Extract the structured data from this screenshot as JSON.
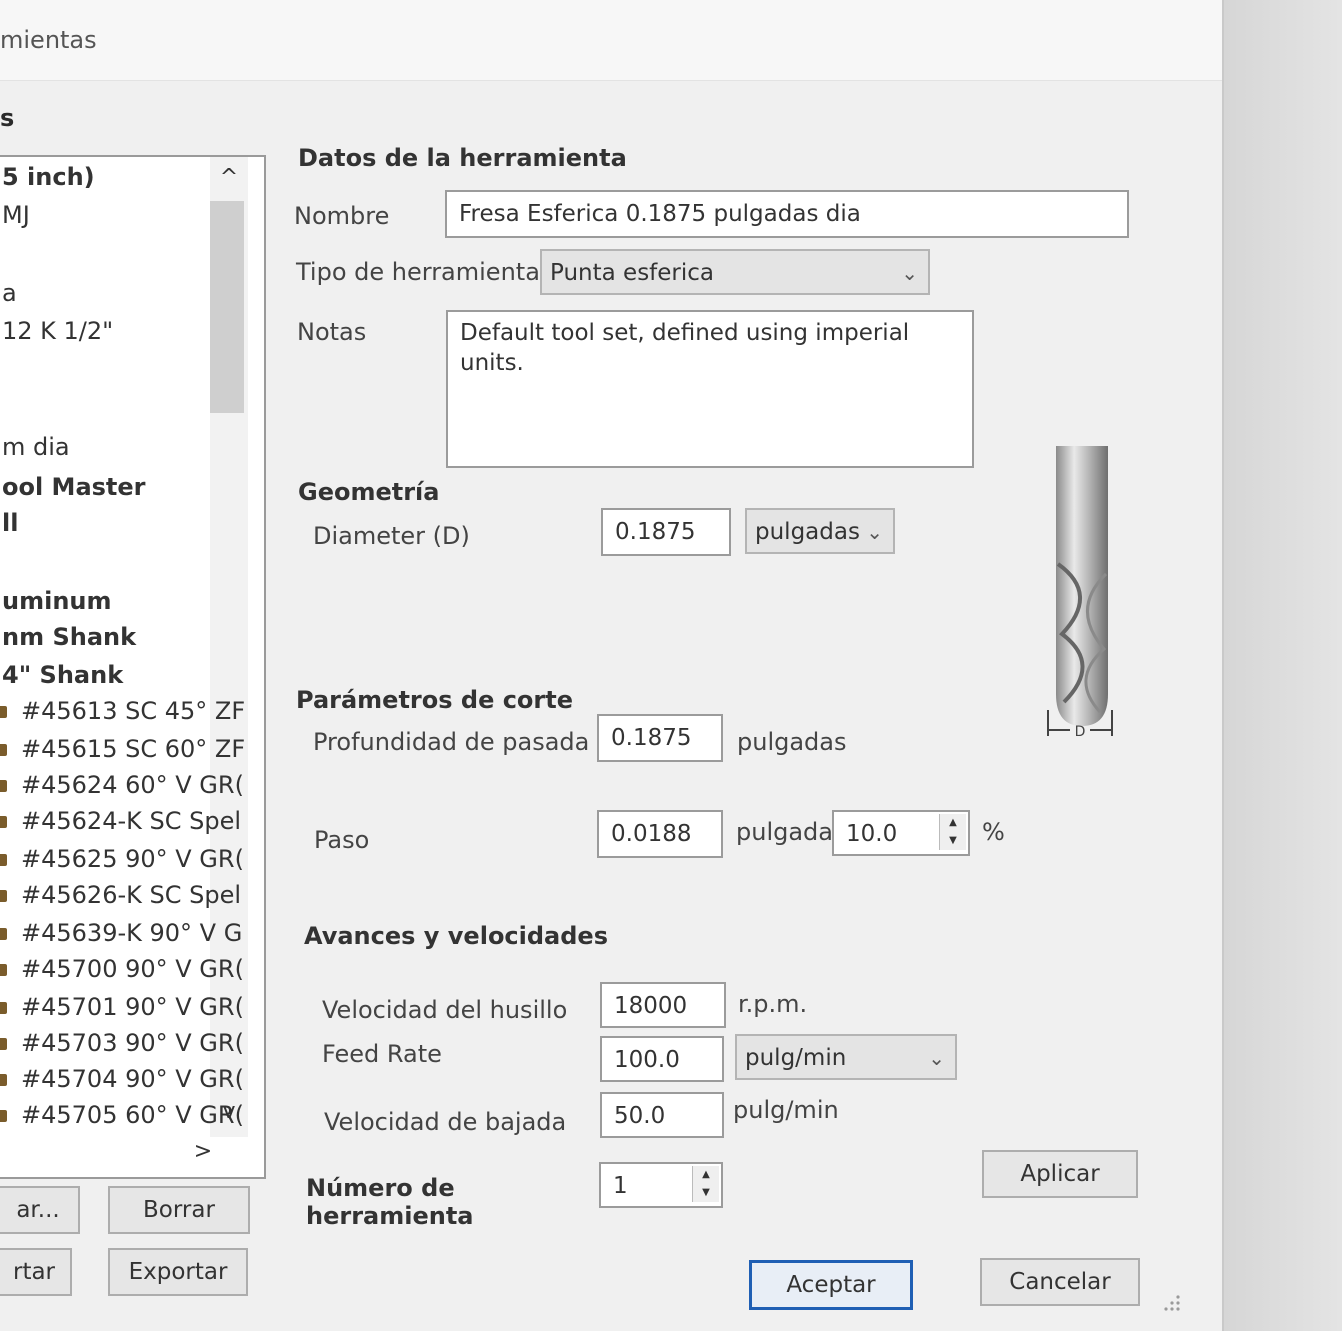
{
  "window": {
    "title": "mientas",
    "list_label": "s"
  },
  "tool_list": {
    "items": [
      {
        "text": "5 inch)",
        "bold": true
      },
      {
        "text": "MJ",
        "bold": false
      },
      {
        "text": "",
        "bold": false
      },
      {
        "text": "a",
        "bold": false
      },
      {
        "text": "12 K 1/2\"",
        "bold": false
      },
      {
        "text": "",
        "bold": false
      },
      {
        "text": "",
        "bold": false
      },
      {
        "text": "m dia",
        "bold": false
      },
      {
        "text": "ool Master",
        "bold": true
      },
      {
        "text": "ll",
        "bold": true
      },
      {
        "text": "",
        "bold": false
      },
      {
        "text": "uminum",
        "bold": true
      },
      {
        "text": "nm Shank",
        "bold": true
      },
      {
        "text": "4\" Shank",
        "bold": true
      },
      {
        "text": "#45613 SC 45° ZF",
        "bold": false
      },
      {
        "text": "#45615 SC 60° ZF",
        "bold": false
      },
      {
        "text": "#45624 60° V GR(",
        "bold": false
      },
      {
        "text": "#45624-K SC Spel",
        "bold": false
      },
      {
        "text": "#45625 90° V GR(",
        "bold": false
      },
      {
        "text": "#45626-K SC Spel",
        "bold": false
      },
      {
        "text": "#45639-K 90° V G",
        "bold": false
      },
      {
        "text": "#45700 90° V GR(",
        "bold": false
      },
      {
        "text": "#45701 90° V GR(",
        "bold": false
      },
      {
        "text": "#45703 90° V GR(",
        "bold": false
      },
      {
        "text": "#45704 90° V GR(",
        "bold": false
      },
      {
        "text": "#45705 60° V GR(",
        "bold": false
      }
    ],
    "scroll_up": "^",
    "scroll_down": "v",
    "scroll_right": ">"
  },
  "list_buttons": {
    "add": "ar...",
    "delete": "Borrar",
    "import": "rtar",
    "export": "Exportar"
  },
  "tool_data": {
    "section": "Datos de la herramienta",
    "name_label": "Nombre",
    "name_value": "Fresa Esferica 0.1875 pulgadas dia",
    "type_label": "Tipo de herramienta",
    "type_value": "Punta esferica",
    "notes_label": "Notas",
    "notes_value": "Default tool set, defined using imperial units."
  },
  "geometry": {
    "section": "Geometría",
    "diameter_label": "Diameter (D)",
    "diameter_value": "0.1875",
    "units_value": "pulgadas",
    "diagram_label": "D"
  },
  "cutting": {
    "section": "Parámetros de corte",
    "pass_depth_label": "Profundidad de pasada",
    "pass_depth_value": "0.1875",
    "pass_depth_unit": "pulgadas",
    "stepover_label": "Paso",
    "stepover_value": "0.0188",
    "stepover_unit": "pulgada",
    "stepover_percent": "10.0",
    "percent_sign": "%"
  },
  "feeds": {
    "section": "Avances y velocidades",
    "spindle_label": "Velocidad del husillo",
    "spindle_value": "18000",
    "spindle_unit": "r.p.m.",
    "feed_label": "Feed Rate",
    "feed_value": "100.0",
    "feed_unit": "pulg/min",
    "plunge_label": "Velocidad de bajada",
    "plunge_value": "50.0",
    "plunge_unit": "pulg/min"
  },
  "tool_number": {
    "label_line1": "Número de",
    "label_line2": "herramienta",
    "value": "1"
  },
  "buttons": {
    "apply": "Aplicar",
    "ok": "Aceptar",
    "cancel": "Cancelar"
  }
}
